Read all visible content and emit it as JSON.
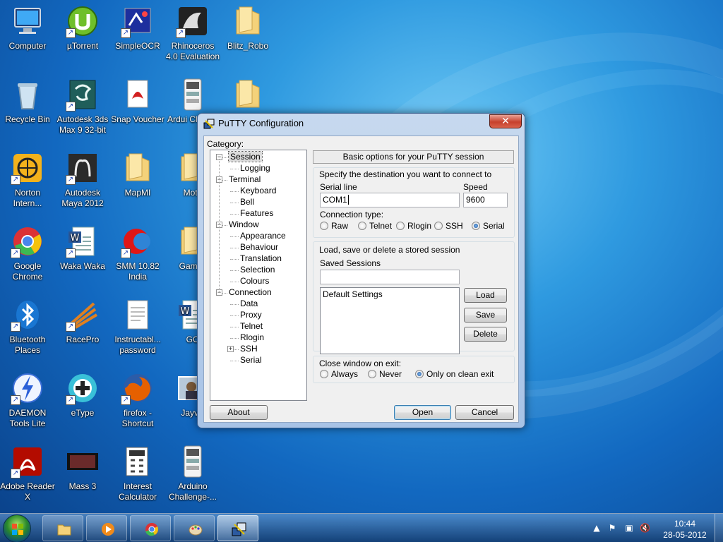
{
  "desktop": {
    "icons": [
      {
        "label": "Computer",
        "icon": "computer-icon"
      },
      {
        "label": "µTorrent",
        "icon": "utorrent-icon"
      },
      {
        "label": "SimpleOCR",
        "icon": "simpleocr-icon"
      },
      {
        "label": "Rhinoceros 4.0 Evaluation",
        "icon": "rhinoceros-icon"
      },
      {
        "label": "Blitz_Robo",
        "icon": "folder-icon"
      },
      {
        "label": "Recycle Bin",
        "icon": "recycle-bin-icon"
      },
      {
        "label": "Autodesk 3ds Max 9 32-bit",
        "icon": "3dsmax-icon"
      },
      {
        "label": "Snap Voucher",
        "icon": "pdf-icon"
      },
      {
        "label": "Ardui Challen",
        "icon": "document-icon"
      },
      {
        "label": "",
        "icon": "folder-icon"
      },
      {
        "label": "Norton Intern...",
        "icon": "norton-icon"
      },
      {
        "label": "Autodesk Maya 2012",
        "icon": "maya-icon"
      },
      {
        "label": "MapMI",
        "icon": "folder-icon"
      },
      {
        "label": "Moto",
        "icon": "folder-icon"
      },
      {
        "label": "Google Chrome",
        "icon": "chrome-icon"
      },
      {
        "label": "Waka Waka",
        "icon": "word-document-icon"
      },
      {
        "label": "SMM 10.82 India",
        "icon": "smm-icon"
      },
      {
        "label": "Games",
        "icon": "folder-icon"
      },
      {
        "label": "Bluetooth Places",
        "icon": "bluetooth-icon"
      },
      {
        "label": "RacePro",
        "icon": "racepro-icon"
      },
      {
        "label": "Instructabl... password",
        "icon": "text-file-icon"
      },
      {
        "label": "GO",
        "icon": "word-document-icon"
      },
      {
        "label": "DAEMON Tools Lite",
        "icon": "daemon-tools-icon"
      },
      {
        "label": "eType",
        "icon": "etype-icon"
      },
      {
        "label": "firefox - Shortcut",
        "icon": "firefox-icon"
      },
      {
        "label": "Jayvis",
        "icon": "photo-icon"
      },
      {
        "label": "Adobe Reader X",
        "icon": "adobe-reader-icon"
      },
      {
        "label": "Mass 3",
        "icon": "video-icon"
      },
      {
        "label": "Interest Calculator",
        "icon": "calculator-icon"
      },
      {
        "label": "Arduino Challenge-...",
        "icon": "document-icon"
      }
    ]
  },
  "window": {
    "title": "PuTTY Configuration",
    "close_label": "✕",
    "category_label": "Category:",
    "tree": [
      {
        "label": "Session",
        "level": 0,
        "expander": "−",
        "selected": true
      },
      {
        "label": "Logging",
        "level": 1
      },
      {
        "label": "Terminal",
        "level": 0,
        "expander": "−"
      },
      {
        "label": "Keyboard",
        "level": 1
      },
      {
        "label": "Bell",
        "level": 1
      },
      {
        "label": "Features",
        "level": 1
      },
      {
        "label": "Window",
        "level": 0,
        "expander": "−"
      },
      {
        "label": "Appearance",
        "level": 1
      },
      {
        "label": "Behaviour",
        "level": 1
      },
      {
        "label": "Translation",
        "level": 1
      },
      {
        "label": "Selection",
        "level": 1
      },
      {
        "label": "Colours",
        "level": 1
      },
      {
        "label": "Connection",
        "level": 0,
        "expander": "−"
      },
      {
        "label": "Data",
        "level": 1
      },
      {
        "label": "Proxy",
        "level": 1
      },
      {
        "label": "Telnet",
        "level": 1
      },
      {
        "label": "Rlogin",
        "level": 1
      },
      {
        "label": "SSH",
        "level": 1,
        "expander": "+"
      },
      {
        "label": "Serial",
        "level": 1
      }
    ],
    "banner": "Basic options for your PuTTY session",
    "destination": {
      "heading": "Specify the destination you want to connect to",
      "serial_line_label": "Serial line",
      "serial_line_value": "COM1",
      "speed_label": "Speed",
      "speed_value": "9600",
      "conn_type_label": "Connection type:",
      "conn_types": [
        "Raw",
        "Telnet",
        "Rlogin",
        "SSH",
        "Serial"
      ],
      "conn_type_selected": "Serial"
    },
    "sessions": {
      "heading": "Load, save or delete a stored session",
      "saved_label": "Saved Sessions",
      "saved_value": "",
      "list": [
        "Default Settings"
      ],
      "load_label": "Load",
      "save_label": "Save",
      "delete_label": "Delete"
    },
    "close_exit": {
      "heading": "Close window on exit:",
      "options": [
        "Always",
        "Never",
        "Only on clean exit"
      ],
      "selected": "Only on clean exit"
    },
    "about_label": "About",
    "open_label": "Open",
    "cancel_label": "Cancel"
  },
  "taskbar": {
    "buttons": [
      {
        "icon": "explorer-icon"
      },
      {
        "icon": "media-player-icon"
      },
      {
        "icon": "chrome-icon"
      },
      {
        "icon": "paint-icon"
      },
      {
        "icon": "putty-icon",
        "active": true
      }
    ],
    "tray_icons": [
      "chevron-up-icon",
      "flag-icon",
      "network-icon",
      "volume-muted-icon"
    ],
    "time": "10:44",
    "date": "28-05-2012"
  },
  "colors": {
    "accent": "#1268c0",
    "window_frame": "#a8c3e6",
    "close_button": "#c7402c"
  }
}
